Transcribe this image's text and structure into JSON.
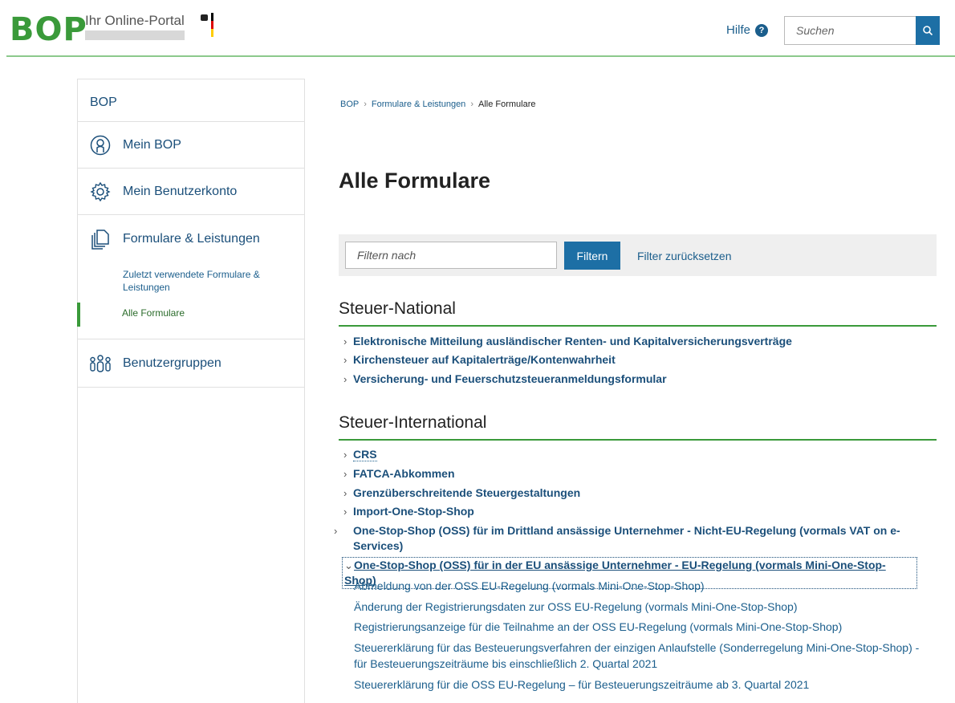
{
  "header": {
    "logo": "BOP",
    "portal_name": "Ihr Online-Portal",
    "help_label": "Hilfe",
    "search_placeholder": "Suchen"
  },
  "sidebar": {
    "head": "BOP",
    "mein_bop": "Mein BOP",
    "benutzerkonto": "Mein Benutzerkonto",
    "formulare": "Formulare & Leistungen",
    "sub_recent": "Zuletzt verwendete Formulare & Leistungen",
    "sub_all": "Alle Formulare",
    "gruppen": "Benutzergruppen"
  },
  "breadcrumb": {
    "items": [
      "BOP",
      "Formulare & Leistungen"
    ],
    "current": "Alle Formulare"
  },
  "page_title": "Alle Formulare",
  "filter": {
    "placeholder": "Filtern nach",
    "button": "Filtern",
    "reset": "Filter zurücksetzen"
  },
  "sections": {
    "national": {
      "title": "Steuer-National",
      "links": [
        "Elektronische Mitteilung ausländischer Renten- und Kapitalversicherungsverträge",
        "Kirchensteuer auf Kapitalerträge/Kontenwahrheit",
        "Versicherung- und Feuerschutzsteueranmeldungsformular"
      ]
    },
    "international": {
      "title": "Steuer-International",
      "links": [
        "CRS",
        "FATCA-Abkommen",
        "Grenzüberschreitende Steuergestaltungen",
        "Import-One-Stop-Shop",
        "One-Stop-Shop (OSS) für im Drittland ansässige Unternehmer - Nicht-EU-Regelung (vormals VAT on e-Services)",
        "One-Stop-Shop (OSS) für in der EU ansässige Unternehmer - EU-Regelung (vormals Mini-One-Stop-Shop)"
      ],
      "sublinks": [
        "Abmeldung von der OSS EU-Regelung (vormals Mini-One-Stop-Shop)",
        "Änderung der Registrierungsdaten zur OSS EU-Regelung (vormals Mini-One-Stop-Shop)",
        "Registrierungsanzeige für die Teilnahme an der OSS EU-Regelung (vormals Mini-One-Stop-Shop)",
        "Steuererklärung für das Besteuerungsverfahren der einzigen Anlaufstelle (Sonderregelung Mini-One-Stop-Shop) - für Besteuerungszeiträume bis einschließlich 2. Quartal 2021",
        "Steuererklärung für die OSS EU-Regelung – für Besteuerungszeiträume ab 3. Quartal 2021"
      ]
    }
  },
  "colors": {
    "brand_green": "#3a9a3a",
    "link_blue": "#1b4f7a",
    "button_blue": "#1d6fa5"
  }
}
